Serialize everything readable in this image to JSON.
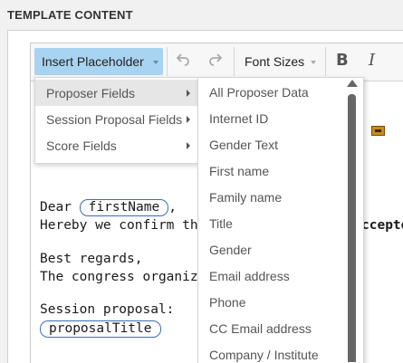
{
  "section": {
    "title": "TEMPLATE CONTENT"
  },
  "toolbar": {
    "insert_placeholder_label": "Insert Placeholder",
    "undo_icon": "undo-arrow",
    "redo_icon": "redo-arrow",
    "font_sizes_label": "Font Sizes",
    "bold_label": "B",
    "italic_label": "I"
  },
  "content": {
    "greeting": "Dear",
    "first_name_placeholder": "firstName",
    "greeting_suffix": ",",
    "line2_prefix": "Hereby we confirm that y",
    "line2_suffix": "ccepte",
    "closing": "Best regards,",
    "signature": "The congress organizer",
    "session_label": "Session proposal:",
    "proposal_title_placeholder": "proposalTitle"
  },
  "placeholder_menu": {
    "categories": [
      {
        "label": "Proposer Fields"
      },
      {
        "label": "Session Proposal Fields"
      },
      {
        "label": "Score Fields"
      }
    ],
    "active_category": "Proposer Fields",
    "fields": [
      {
        "label": "All Proposer Data"
      },
      {
        "label": "Internet ID"
      },
      {
        "label": "Gender Text"
      },
      {
        "label": "First name"
      },
      {
        "label": "Family name"
      },
      {
        "label": "Title"
      },
      {
        "label": "Gender"
      },
      {
        "label": "Email address"
      },
      {
        "label": "Phone"
      },
      {
        "label": "CC Email address"
      },
      {
        "label": "Company / Institute"
      }
    ]
  },
  "colors": {
    "insert_button_bg": "#a8d4f1",
    "placeholder_pill_border": "#3b6fb5",
    "active_menu_item_bg": "#e6e6e6"
  }
}
